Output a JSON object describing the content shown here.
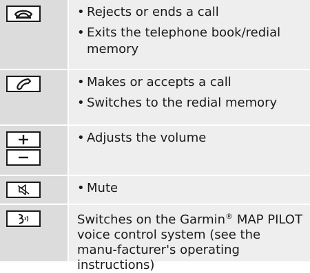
{
  "rows": [
    {
      "key_icon": "end-call-icon",
      "items": [
        "Rejects or ends a call",
        "Exits the telephone book/redial memory"
      ]
    },
    {
      "key_icon": "accept-call-icon",
      "items": [
        "Makes or accepts a call",
        "Switches to the redial memory"
      ]
    },
    {
      "key_icon": "volume-icon",
      "items": [
        "Adjusts the volume"
      ]
    },
    {
      "key_icon": "mute-icon",
      "items": [
        "Mute"
      ]
    },
    {
      "key_icon": "voice-control-icon",
      "text_before": "Switches on the Garmin",
      "registered": "®",
      "text_after": " MAP PILOT voice control system (see the manu-facturer's operating instructions)"
    }
  ]
}
